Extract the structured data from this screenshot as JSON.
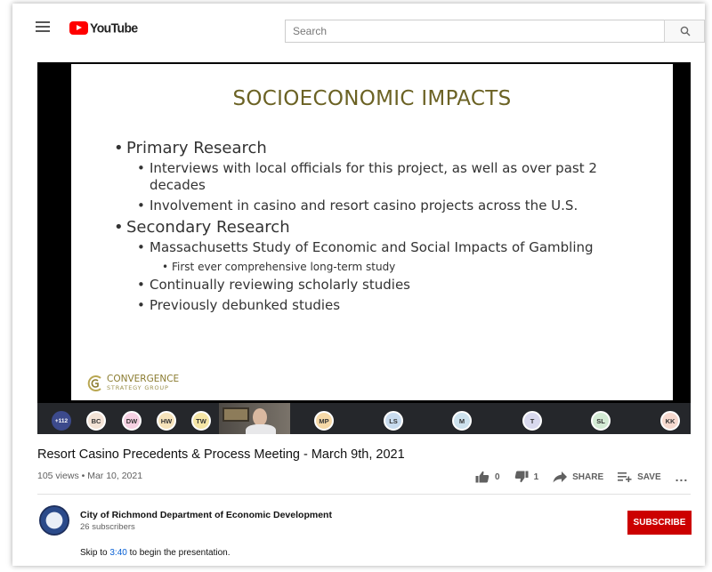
{
  "header": {
    "logo_text": "YouTube",
    "search_placeholder": "Search"
  },
  "slide": {
    "title": "SOCIOECONOMIC IMPACTS",
    "bullets": [
      {
        "level": 1,
        "text": "Primary Research"
      },
      {
        "level": 2,
        "text": "Interviews with local officials for this project, as well as over past 2 decades"
      },
      {
        "level": 2,
        "text": "Involvement in casino and resort casino projects across the U.S."
      },
      {
        "level": 1,
        "text": "Secondary Research"
      },
      {
        "level": 2,
        "text": "Massachusetts Study of Economic and Social Impacts of Gambling"
      },
      {
        "level": 3,
        "text": "First ever comprehensive long-term study"
      },
      {
        "level": 2,
        "text": "Continually reviewing scholarly studies"
      },
      {
        "level": 2,
        "text": "Previously debunked studies"
      }
    ],
    "brand_line1": "CONVERGENCE",
    "brand_line2": "STRATEGY GROUP"
  },
  "participants": [
    {
      "initials": "+112",
      "color": "#3c4a8c",
      "text_color": "#ffffff"
    },
    {
      "initials": "BC",
      "color": "#f3e3d6",
      "text_color": "#333333"
    },
    {
      "initials": "DW",
      "color": "#f7d1e3",
      "text_color": "#333333"
    },
    {
      "initials": "HW",
      "color": "#f6e3bb",
      "text_color": "#333333"
    },
    {
      "initials": "TW",
      "color": "#f6e6a6",
      "text_color": "#333333"
    },
    {
      "initials": "MP",
      "color": "#f6d9a8",
      "text_color": "#333333"
    },
    {
      "initials": "LS",
      "color": "#c9dcef",
      "text_color": "#333333"
    },
    {
      "initials": "M",
      "color": "#cde2ee",
      "text_color": "#333333"
    },
    {
      "initials": "T",
      "color": "#d9d9ee",
      "text_color": "#333333"
    },
    {
      "initials": "SL",
      "color": "#d4ebd5",
      "text_color": "#333333"
    },
    {
      "initials": "KK",
      "color": "#f6d9cf",
      "text_color": "#333333"
    }
  ],
  "video": {
    "title": "Resort Casino Precedents & Process Meeting - March 9th, 2021",
    "meta": "105 views • Mar 10, 2021",
    "likes": "0",
    "dislikes": "1",
    "share_label": "SHARE",
    "save_label": "SAVE",
    "more_label": "..."
  },
  "channel": {
    "name": "City of Richmond Department of Economic Development",
    "subscribers": "26 subscribers",
    "subscribe_label": "SUBSCRIBE"
  },
  "description": {
    "prefix": "Skip to ",
    "timestamp": "3:40",
    "suffix": " to begin the presentation."
  },
  "colors": {
    "brand_red": "#ff0000",
    "subscribe_red": "#cc0000",
    "link_blue": "#065fd4",
    "slide_title": "#6b6224"
  }
}
